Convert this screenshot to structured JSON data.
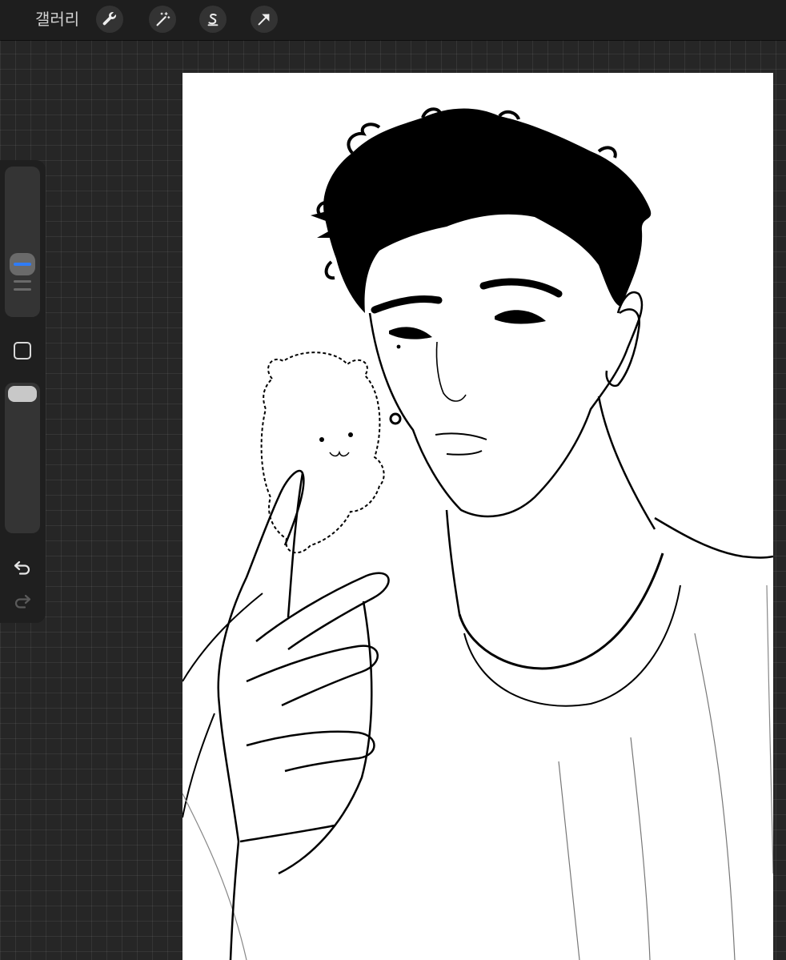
{
  "topbar": {
    "gallery_label": "갤러리",
    "tools": [
      {
        "name": "actions",
        "icon": "wrench-icon"
      },
      {
        "name": "adjustments",
        "icon": "magic-wand-icon"
      },
      {
        "name": "selection",
        "icon": "s-curve-icon"
      },
      {
        "name": "transform",
        "icon": "arrow-icon"
      }
    ]
  },
  "sidebar": {
    "brush_size_icon": "slider-thumb",
    "modify_icon": "square-icon",
    "undo_icon": "undo-icon",
    "redo_icon": "redo-icon"
  },
  "canvas": {
    "artwork": "lineart-drawing"
  },
  "colors": {
    "accent": "#2f7cf6",
    "toolbar_bg": "#1e1e1e",
    "workspace_bg": "#262626",
    "canvas_bg": "#ffffff"
  }
}
